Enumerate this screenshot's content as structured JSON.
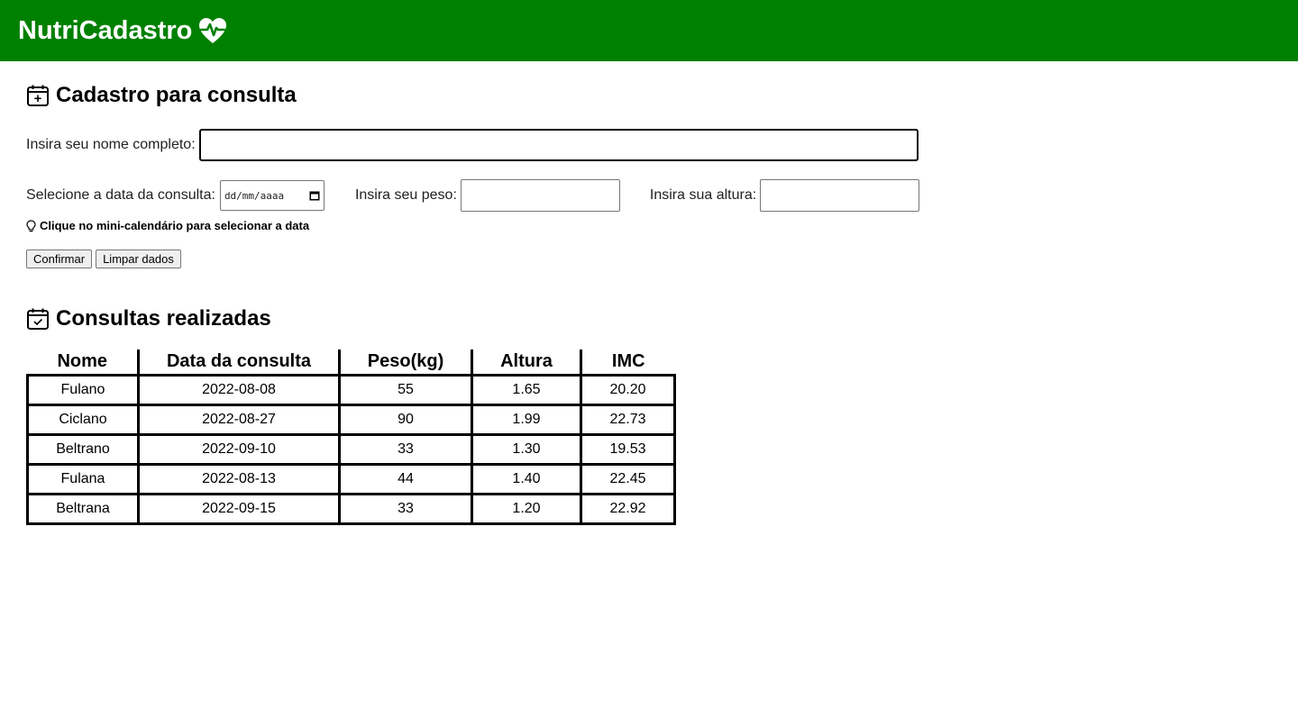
{
  "app": {
    "title": "NutriCadastro",
    "brand_color": "#008000",
    "logo_icon": "heart-pulse-icon"
  },
  "form": {
    "heading": "Cadastro para consulta",
    "heading_icon": "calendar-plus-icon",
    "name_label": "Insira seu nome completo:",
    "name_value": "",
    "date_label": "Selecione a data da consulta:",
    "date_placeholder": "dd/mm/aaaa",
    "weight_label": "Insira seu peso:",
    "weight_value": "",
    "height_label": "Insira sua altura:",
    "height_value": "",
    "hint": "Clique no mini-calendário para selecionar a data",
    "hint_icon": "lightbulb-icon",
    "confirm_label": "Confirmar",
    "clear_label": "Limpar dados"
  },
  "consultations": {
    "heading": "Consultas realizadas",
    "heading_icon": "calendar-check-icon",
    "columns": [
      "Nome",
      "Data da consulta",
      "Peso(kg)",
      "Altura",
      "IMC"
    ],
    "rows": [
      [
        "Fulano",
        "2022-08-08",
        "55",
        "1.65",
        "20.20"
      ],
      [
        "Ciclano",
        "2022-08-27",
        "90",
        "1.99",
        "22.73"
      ],
      [
        "Beltrano",
        "2022-09-10",
        "33",
        "1.30",
        "19.53"
      ],
      [
        "Fulana",
        "2022-08-13",
        "44",
        "1.40",
        "22.45"
      ],
      [
        "Beltrana",
        "2022-09-15",
        "33",
        "1.20",
        "22.92"
      ]
    ]
  }
}
